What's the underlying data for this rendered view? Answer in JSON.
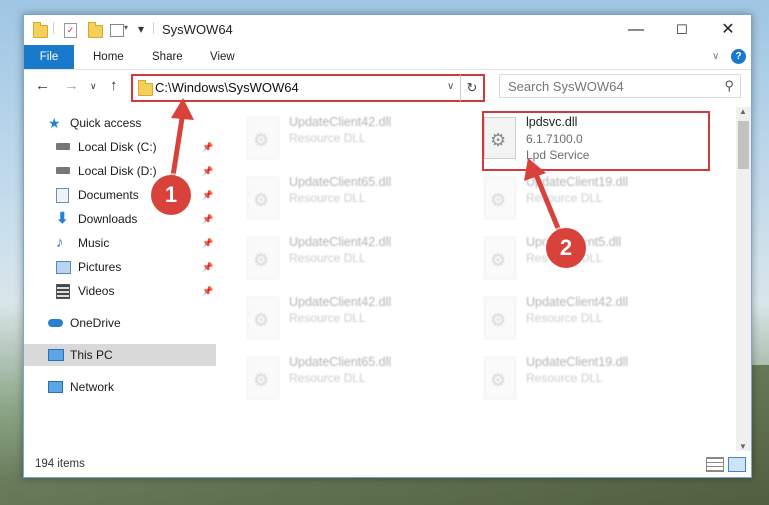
{
  "window": {
    "title": "SysWOW64",
    "minimize": "—",
    "maximize": "☐",
    "close": "✕"
  },
  "ribbon": {
    "tabs": [
      "File",
      "Home",
      "Share",
      "View"
    ],
    "chevron": "∨",
    "help": "?"
  },
  "nav": {
    "back": "←",
    "forward": "→",
    "recent": "∨",
    "up": "↑",
    "address": "C:\\Windows\\SysWOW64",
    "address_dropdown": "∨",
    "refresh": "↻",
    "search_placeholder": "Search SysWOW64",
    "search_icon": "search-icon"
  },
  "sidebar": {
    "items": [
      {
        "label": "Quick access",
        "icon": "star-icon",
        "pinned": false
      },
      {
        "label": "Local Disk (C:)",
        "icon": "drive-icon",
        "pinned": true
      },
      {
        "label": "Local Disk (D:)",
        "icon": "drive-icon",
        "pinned": true
      },
      {
        "label": "Documents",
        "icon": "documents-icon",
        "pinned": true
      },
      {
        "label": "Downloads",
        "icon": "downloads-icon",
        "pinned": true
      },
      {
        "label": "Music",
        "icon": "music-icon",
        "pinned": true
      },
      {
        "label": "Pictures",
        "icon": "pictures-icon",
        "pinned": true
      },
      {
        "label": "Videos",
        "icon": "videos-icon",
        "pinned": true
      },
      {
        "label": "OneDrive",
        "icon": "onedrive-icon",
        "pinned": false
      },
      {
        "label": "This PC",
        "icon": "pc-icon",
        "pinned": false,
        "selected": true
      },
      {
        "label": "Network",
        "icon": "network-icon",
        "pinned": false
      }
    ]
  },
  "files": {
    "left_column": [
      {
        "name": "UpdateClient42.dll",
        "type": "Resource DLL"
      },
      {
        "name": "UpdateClient65.dll",
        "type": "Resource DLL"
      },
      {
        "name": "UpdateClient42.dll",
        "type": "Resource DLL"
      },
      {
        "name": "UpdateClient42.dll",
        "type": "Resource DLL"
      },
      {
        "name": "UpdateClient65.dll",
        "type": "Resource DLL"
      }
    ],
    "right_column": [
      {
        "name": "lpdsvc.dll",
        "version": "6.1.7100.0",
        "type": "Lpd Service"
      },
      {
        "name": "UpdateClient19.dll",
        "type": "Resource DLL"
      },
      {
        "name": "UpdateClient5.dll",
        "type": "Resource DLL"
      },
      {
        "name": "UpdateClient42.dll",
        "type": "Resource DLL"
      },
      {
        "name": "UpdateClient19.dll",
        "type": "Resource DLL"
      }
    ]
  },
  "status": {
    "item_count": "194 items"
  },
  "annotations": {
    "step1": "1",
    "step2": "2",
    "color": "#d9423b"
  },
  "colors": {
    "accent": "#1979ca",
    "highlight": "#d23a3a"
  }
}
